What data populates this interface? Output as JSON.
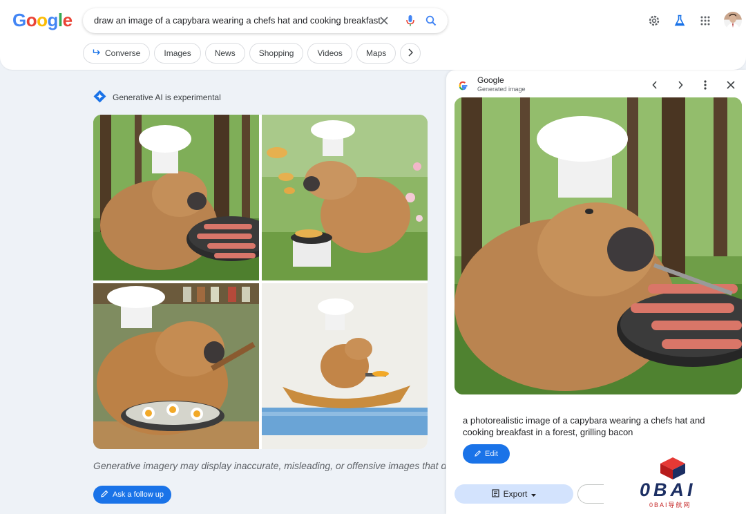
{
  "header": {
    "logo_letters": [
      {
        "ch": "G",
        "color": "#4285F4"
      },
      {
        "ch": "o",
        "color": "#EA4335"
      },
      {
        "ch": "o",
        "color": "#FBBC05"
      },
      {
        "ch": "g",
        "color": "#4285F4"
      },
      {
        "ch": "l",
        "color": "#34A853"
      },
      {
        "ch": "e",
        "color": "#EA4335"
      }
    ],
    "search_query": "draw an image of a capybara wearing a chefs hat and cooking breakfast",
    "icons": [
      "clear-icon",
      "mic-icon",
      "search-icon",
      "settings-icon",
      "labs-icon",
      "apps-icon",
      "avatar"
    ]
  },
  "chips": [
    {
      "label": "Converse",
      "icon": "converse-arrow-icon"
    },
    {
      "label": "Images"
    },
    {
      "label": "News"
    },
    {
      "label": "Shopping"
    },
    {
      "label": "Videos"
    },
    {
      "label": "Maps"
    }
  ],
  "ai_label": "Generative AI is experimental",
  "disclaimer": "Generative imagery may display inaccurate, misleading, or offensive images that do",
  "followup_label": "Ask a follow up",
  "panel": {
    "title": "Google",
    "subtitle": "Generated image",
    "caption": "a photorealistic image of a capybara wearing a chefs hat and cooking breakfast in a forest, grilling bacon",
    "edit_label": "Edit",
    "export_label": "Export"
  },
  "watermark": {
    "text": "0BAI",
    "subtext": "0BAI导航网"
  },
  "colors": {
    "accent": "#1a73e8",
    "page_bg": "#eef2f7"
  }
}
